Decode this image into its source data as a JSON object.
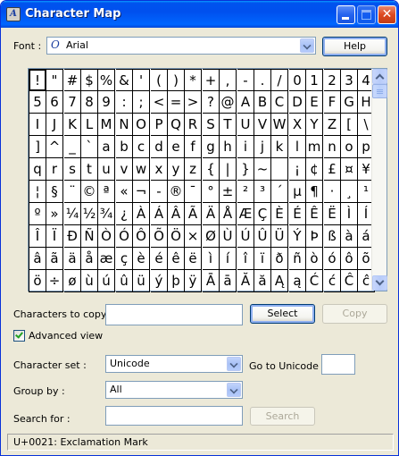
{
  "window": {
    "title": "Character Map",
    "app_icon_glyph": "A",
    "buttons": [
      "minimize",
      "maximize",
      "close"
    ],
    "close_glyph": "✕"
  },
  "font": {
    "label": "Font :",
    "value": "Arial",
    "type_glyph": "O"
  },
  "help_button": "Help",
  "grid": {
    "rows": [
      [
        "!",
        "\"",
        "#",
        "$",
        "%",
        "&",
        "'",
        "(",
        ")",
        "*",
        "+",
        ",",
        "-",
        ".",
        "/",
        "0",
        "1",
        "2",
        "3",
        "4"
      ],
      [
        "5",
        "6",
        "7",
        "8",
        "9",
        ":",
        ";",
        "<",
        "=",
        ">",
        "?",
        "@",
        "A",
        "B",
        "C",
        "D",
        "E",
        "F",
        "G",
        "H"
      ],
      [
        "I",
        "J",
        "K",
        "L",
        "M",
        "N",
        "O",
        "P",
        "Q",
        "R",
        "S",
        "T",
        "U",
        "V",
        "W",
        "X",
        "Y",
        "Z",
        "[",
        "\\"
      ],
      [
        "]",
        "^",
        "_",
        "`",
        "a",
        "b",
        "c",
        "d",
        "e",
        "f",
        "g",
        "h",
        "i",
        "j",
        "k",
        "l",
        "m",
        "n",
        "o",
        "p"
      ],
      [
        "q",
        "r",
        "s",
        "t",
        "u",
        "v",
        "w",
        "x",
        "y",
        "z",
        "{",
        "|",
        "}",
        "~",
        " ",
        "¡",
        "¢",
        "£",
        "¤",
        "¥"
      ],
      [
        "¦",
        "§",
        "¨",
        "©",
        "ª",
        "«",
        "¬",
        "-",
        "®",
        "¯",
        "°",
        "±",
        "²",
        "³",
        "´",
        "µ",
        "¶",
        "·",
        "¸",
        "¹"
      ],
      [
        "º",
        "»",
        "¼",
        "½",
        "¾",
        "¿",
        "À",
        "Á",
        "Â",
        "Ã",
        "Ä",
        "Å",
        "Æ",
        "Ç",
        "È",
        "É",
        "Ê",
        "Ë",
        "Ì",
        "Í"
      ],
      [
        "Î",
        "Ï",
        "Ð",
        "Ñ",
        "Ò",
        "Ó",
        "Ô",
        "Õ",
        "Ö",
        "×",
        "Ø",
        "Ù",
        "Ú",
        "Û",
        "Ü",
        "Ý",
        "Þ",
        "ß",
        "à",
        "á"
      ],
      [
        "â",
        "ã",
        "ä",
        "å",
        "æ",
        "ç",
        "è",
        "é",
        "ê",
        "ë",
        "ì",
        "í",
        "î",
        "ï",
        "ð",
        "ñ",
        "ò",
        "ó",
        "ô",
        "õ"
      ],
      [
        "ö",
        "÷",
        "ø",
        "ù",
        "ú",
        "û",
        "ü",
        "ý",
        "þ",
        "ÿ",
        "Ā",
        "ā",
        "Ă",
        "ă",
        "Ą",
        "ą",
        "Ć",
        "ć",
        "Ĉ",
        "ĉ"
      ]
    ],
    "selected": "!"
  },
  "copy": {
    "label": "Characters to copy :",
    "value": "",
    "select_button": "Select",
    "copy_button": "Copy"
  },
  "advanced": {
    "label": "Advanced view",
    "checked": true
  },
  "charset": {
    "label": "Character set :",
    "value": "Unicode",
    "goto_label": "Go to Unicode :",
    "goto_value": ""
  },
  "group": {
    "label": "Group by :",
    "value": "All"
  },
  "search": {
    "label": "Search for :",
    "value": "",
    "button": "Search"
  },
  "status": {
    "text": "U+0021: Exclamation Mark"
  },
  "colors": {
    "titlebar": "#0054e3",
    "face": "#ece9d8",
    "border": "#7f9db9"
  }
}
